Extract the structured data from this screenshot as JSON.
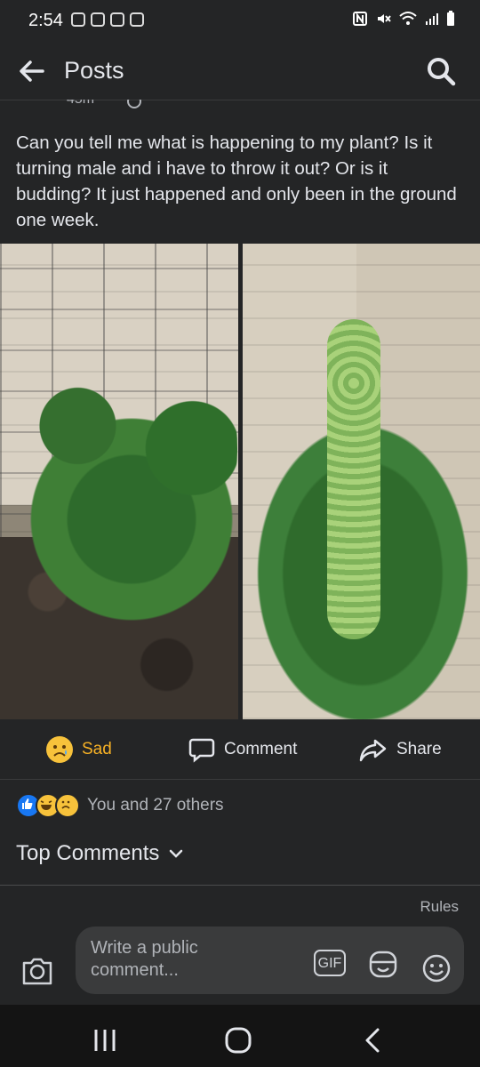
{
  "status_bar": {
    "time": "2:54"
  },
  "header": {
    "title": "Posts"
  },
  "post": {
    "meta_cut": "45m",
    "text": "Can you tell me what is happening to my plant?  Is it turning male and i have to throw it out? Or is it budding?  It just happened and only been in the ground one week."
  },
  "actions": {
    "reaction_label": "Sad",
    "comment_label": "Comment",
    "share_label": "Share"
  },
  "reactions": {
    "summary": "You and 27 others",
    "types": [
      "like",
      "haha",
      "sad"
    ]
  },
  "comments": {
    "sort_label": "Top Comments",
    "rules_link": "Rules"
  },
  "composer": {
    "placeholder": "Write a public comment...",
    "gif_label": "GIF"
  },
  "icons": {
    "back": "arrow-left-icon",
    "search": "search-icon",
    "camera": "camera-icon",
    "sticker": "sticker-icon",
    "emoji": "emoji-icon",
    "recents": "recent-apps-icon",
    "home": "home-icon",
    "nav_back": "chevron-left-icon"
  },
  "colors": {
    "background": "#242526",
    "accent": "#f7b125",
    "text": "#e4e6eb",
    "muted": "#b0b3b8"
  }
}
